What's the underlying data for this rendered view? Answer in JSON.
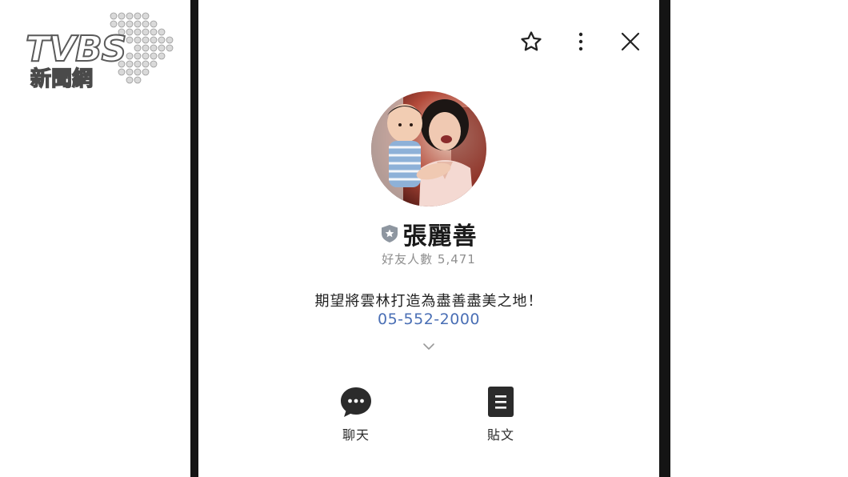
{
  "watermark": {
    "brand": "TVBS",
    "subtitle": "新聞網"
  },
  "topbar": {
    "icons": [
      "star-icon",
      "more-vert-icon",
      "close-icon"
    ]
  },
  "profile": {
    "name": "張麗善",
    "badge_icon": "shield-badge-icon",
    "friends": "好友人數 5,471",
    "status_message": "期望將雲林打造為盡善盡美之地！",
    "phone": "05-552-2000"
  },
  "actions": {
    "chat_label": "聊天",
    "posts_label": "貼文"
  },
  "colors": {
    "link": "#4a6fb5",
    "frame": "#141414",
    "icon_dark": "#222222"
  }
}
